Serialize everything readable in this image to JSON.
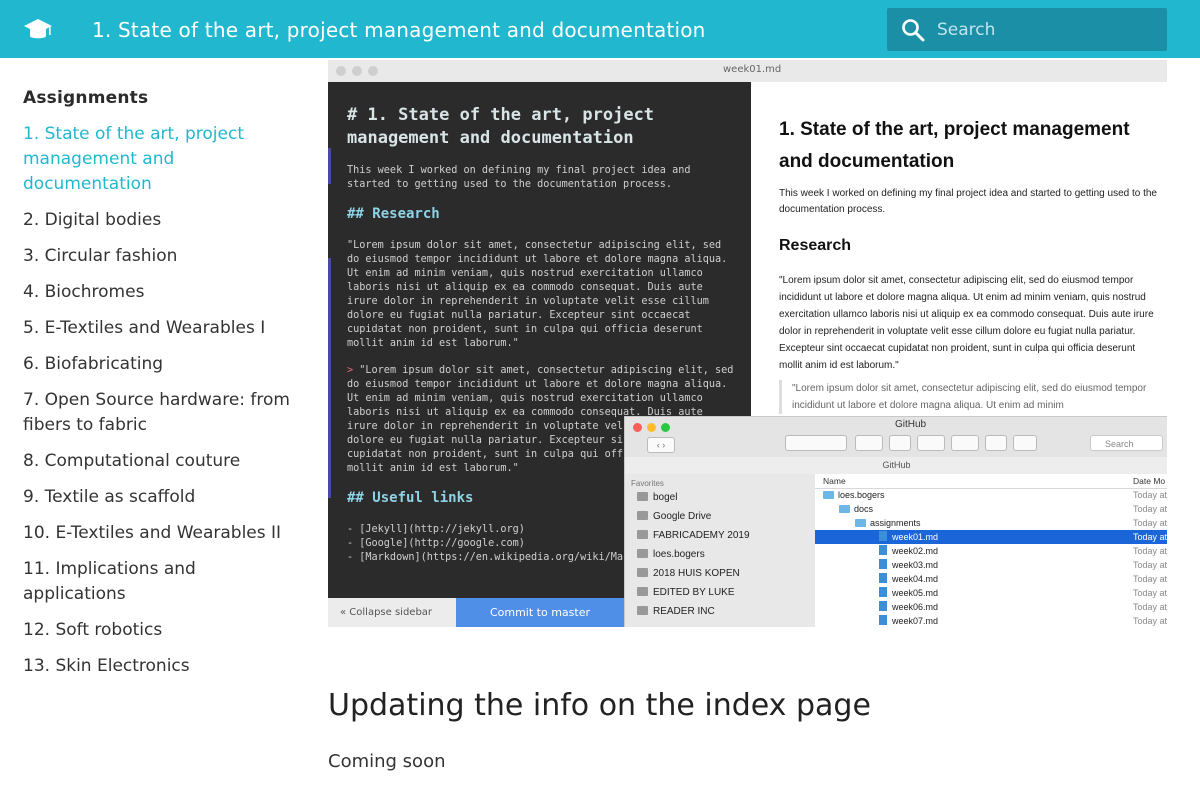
{
  "header": {
    "title": "1. State of the art, project management and documentation",
    "search_placeholder": "Search",
    "icons": {
      "logo": "graduation-cap-icon",
      "search": "search-icon"
    }
  },
  "sidebar": {
    "heading": "Assignments",
    "active_index": 0,
    "items": [
      "1. State of the art, project management and documentation",
      "2. Digital bodies",
      "3. Circular fashion",
      "4. Biochromes",
      "5. E-Textiles and Wearables I",
      "6. Biofabricating",
      "7. Open Source hardware: from fibers to fabric",
      "8. Computational couture",
      "9. Textile as scaffold",
      "10. E-Textiles and Wearables II",
      "11. Implications and applications",
      "12. Soft robotics",
      "13. Skin Electronics"
    ]
  },
  "screenshot": {
    "editor_filename": "week01.md",
    "md_h1": "# 1. State of the art, project management and documentation",
    "md_intro": "This week I worked on defining my final project idea and\nstarted to getting used to the documentation process.",
    "md_h2_research": "## Research",
    "md_lorem": "\"Lorem ipsum dolor sit amet, consectetur adipiscing elit, sed\ndo eiusmod tempor incididunt ut labore et dolore magna aliqua.\nUt enim ad minim veniam, quis nostrud exercitation ullamco\nlaboris nisi ut aliquip ex ea commodo consequat. Duis aute\nirure dolor in reprehenderit in voluptate velit esse cillum\ndolore eu fugiat nulla pariatur. Excepteur sint occaecat\ncupidatat non proident, sunt in culpa qui officia deserunt\nmollit anim id est laborum.\"",
    "md_quote_marker": ">",
    "md_quote": " \"Lorem ipsum dolor sit amet, consectetur adipiscing elit, sed\ndo eiusmod tempor incididunt ut labore et dolore magna aliqua.\nUt enim ad minim veniam, quis nostrud exercitation ullamco\nlaboris nisi ut aliquip ex ea commodo consequat. Duis aute\nirure dolor in reprehenderit in voluptate vel\ndolore eu fugiat nulla pariatur. Excepteur si\ncupidatat non proident, sunt in culpa qui off\nmollit anim id est laborum.\"",
    "md_h2_links": "## Useful links",
    "md_links": "- [Jekyll](http://jekyll.org)\n- [Google](http://google.com)\n- [Markdown](https://en.wikipedia.org/wiki/Ma",
    "collapse_label": "« Collapse sidebar",
    "commit_label": "Commit to master",
    "preview_h1": "1. State of the art, project management and documentation",
    "preview_intro": "This week I worked on defining my final project idea and started to getting used to the documentation process.",
    "preview_h2": "Research",
    "preview_lorem": "\"Lorem ipsum dolor sit amet, consectetur adipiscing elit, sed do eiusmod tempor incididunt ut labore et dolore magna aliqua. Ut enim ad minim veniam, quis nostrud exercitation ullamco laboris nisi ut aliquip ex ea commodo consequat. Duis aute irure dolor in reprehenderit in voluptate velit esse cillum dolore eu fugiat nulla pariatur. Excepteur sint occaecat cupidatat non proident, sunt in culpa qui officia deserunt mollit anim id est laborum.\"",
    "preview_quote": "\"Lorem ipsum dolor sit amet, consectetur adipiscing elit, sed do eiusmod tempor incididunt ut labore et dolore magna aliqua. Ut enim ad minim",
    "finder": {
      "title": "GitHub",
      "path": "GitHub",
      "search": "Search",
      "favorites_label": "Favorites",
      "favorites": [
        "bogel",
        "Google Drive",
        "FABRICADEMY 2019",
        "loes.bogers",
        "2018 HUIS KOPEN",
        "EDITED BY LUKE",
        "READER INC"
      ],
      "col_name": "Name",
      "col_date": "Date Mo",
      "rows": [
        {
          "name": "loes.bogers",
          "type": "folder",
          "depth": 0,
          "date": "Today at"
        },
        {
          "name": "docs",
          "type": "folder",
          "depth": 1,
          "date": "Today at"
        },
        {
          "name": "assignments",
          "type": "folder",
          "depth": 2,
          "date": "Today at"
        },
        {
          "name": "week01.md",
          "type": "file",
          "depth": 3,
          "date": "Today at",
          "selected": true
        },
        {
          "name": "week02.md",
          "type": "file",
          "depth": 3,
          "date": "Today at"
        },
        {
          "name": "week03.md",
          "type": "file",
          "depth": 3,
          "date": "Today at"
        },
        {
          "name": "week04.md",
          "type": "file",
          "depth": 3,
          "date": "Today at"
        },
        {
          "name": "week05.md",
          "type": "file",
          "depth": 3,
          "date": "Today at"
        },
        {
          "name": "week06.md",
          "type": "file",
          "depth": 3,
          "date": "Today at"
        },
        {
          "name": "week07.md",
          "type": "file",
          "depth": 3,
          "date": "Today at"
        }
      ]
    }
  },
  "content": {
    "section_title": "Updating the info on the index page",
    "section_text": "Coming soon"
  },
  "colors": {
    "accent": "#21b8cf",
    "search_bg": "#1b8fa5"
  }
}
